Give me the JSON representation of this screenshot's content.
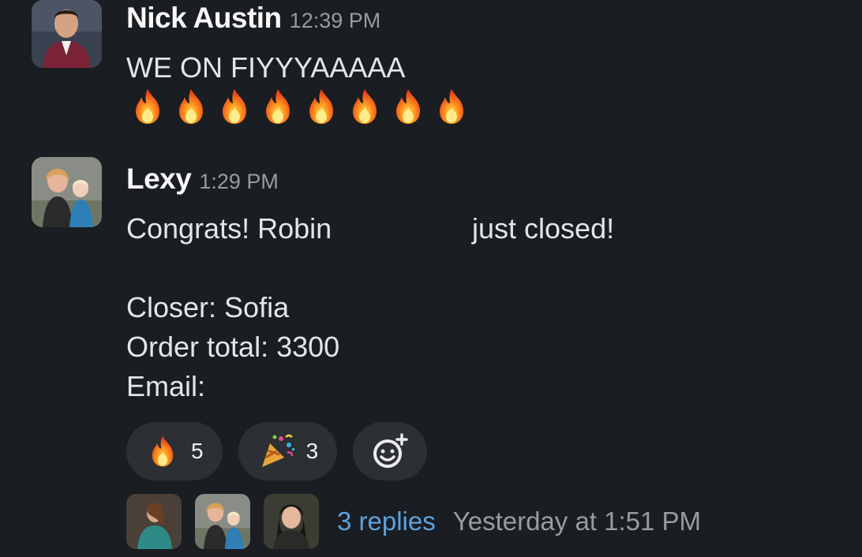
{
  "messages": [
    {
      "author": "Nick Austin",
      "time": "12:39 PM",
      "text": "WE ON FIYYYAAAAA",
      "emoji": "fire",
      "emoji_count": 8
    },
    {
      "author": "Lexy",
      "time": "1:29 PM",
      "line1_start": "Congrats! Robin",
      "line1_end": "just closed!",
      "closer": "Closer: Sofia",
      "order_total": "Order total: 3300",
      "email": "Email:",
      "reactions": [
        {
          "emoji": "fire",
          "count": "5"
        },
        {
          "emoji": "party-popper",
          "count": "3"
        }
      ],
      "thread": {
        "replies": "3 replies",
        "last_reply": "Yesterday at 1:51 PM"
      }
    }
  ],
  "colors": {
    "background": "#1a1d21",
    "link": "#5aa3e0",
    "pill": "#2c2f33"
  }
}
